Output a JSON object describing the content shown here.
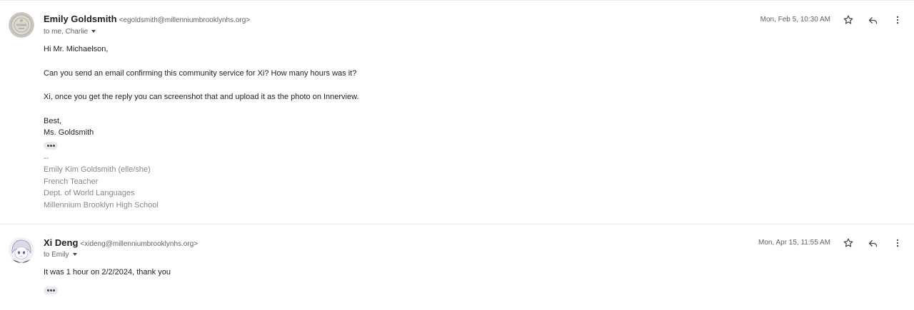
{
  "messages": [
    {
      "sender_name": "Emily Goldsmith",
      "sender_email": "<egoldsmith@millenniumbrooklynhs.org>",
      "to_text": "to me, Charlie",
      "date": "Mon, Feb 5, 10:30 AM",
      "body": {
        "greeting": "Hi Mr. Michaelson,",
        "line1": "Can you send an email confirming this community service for Xi? How many hours was it?",
        "line2": "Xi, once you get the reply you can screenshot that and upload it as the photo on Innerview.",
        "closing": "Best,",
        "signoff": "Ms. Goldsmith"
      },
      "signature": {
        "separator": "--",
        "name": "Emily Kim Goldsmith (elle/she)",
        "title": "French Teacher",
        "dept": "Dept. of World Languages",
        "school": "Millennium Brooklyn High School"
      },
      "avatar_icon": "school-seal-icon"
    },
    {
      "sender_name": "Xi Deng",
      "sender_email": "<xideng@millenniumbrooklynhs.org>",
      "to_text": "to Emily",
      "date": "Mon, Apr 15, 11:55 AM",
      "body": {
        "line1": "It was 1 hour on 2/2/2024, thank you"
      },
      "avatar_icon": "anime-avatar-icon"
    }
  ],
  "icons": {
    "star": "star-outline-icon",
    "reply": "reply-arrow-icon",
    "more": "vertical-dots-icon",
    "expand": "show-trimmed-content-icon"
  },
  "colors": {
    "text_primary": "#1f1f1f",
    "text_secondary": "#5f6368",
    "signature_grey": "#888888",
    "divider": "#eceff1"
  }
}
